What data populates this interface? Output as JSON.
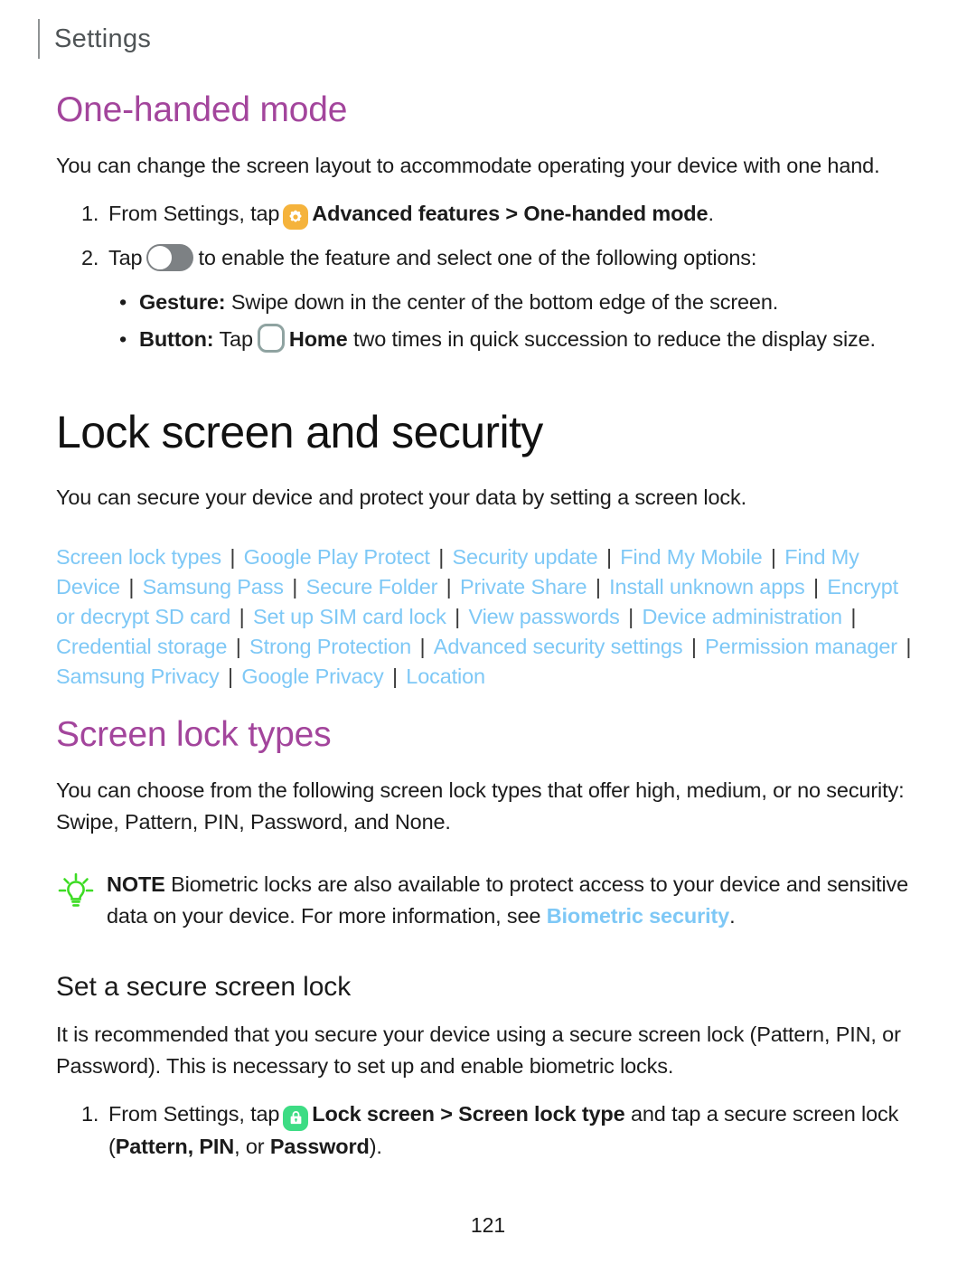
{
  "header": {
    "title": "Settings"
  },
  "one_handed": {
    "heading": "One-handed mode",
    "intro": "You can change the screen layout to accommodate operating your device with one hand.",
    "step1": {
      "number": "1.",
      "pre": "From Settings, tap",
      "icon": "gear-icon",
      "bold1": "Advanced features",
      "chevron": ">",
      "bold2": "One-handed mode",
      "post": "."
    },
    "step2": {
      "number": "2.",
      "pre": "Tap",
      "icon": "toggle-switch-off",
      "post": "to enable the feature and select one of the following options:"
    },
    "bullets": [
      {
        "dot": "•",
        "label": "Gesture",
        "colon": ":",
        "text": "Swipe down in the center of the bottom edge of the screen."
      },
      {
        "dot": "•",
        "label": "Button",
        "colon": ":",
        "pre": "Tap",
        "icon": "home-button-icon",
        "bold": "Home",
        "text": "two times in quick succession to reduce the display size."
      }
    ]
  },
  "lock_screen": {
    "heading": "Lock screen and security",
    "intro": "You can secure your device and protect your data by setting a screen lock.",
    "links": [
      "Screen lock types",
      "Google Play Protect",
      "Security update",
      "Find My Mobile",
      "Find My Device",
      "Samsung Pass",
      "Secure Folder",
      "Private Share",
      "Install unknown apps",
      "Encrypt or decrypt SD card",
      "Set up SIM card lock",
      "View passwords",
      "Device administration",
      "Credential storage",
      "Strong Protection",
      "Advanced security settings",
      "Permission manager",
      "Samsung Privacy",
      "Google Privacy",
      "Location"
    ],
    "link_separator": "|"
  },
  "screen_lock_types": {
    "heading": "Screen lock types",
    "intro": "You can choose from the following screen lock types that offer high, medium, or no security: Swipe, Pattern, PIN, Password, and None.",
    "note": {
      "icon": "lightbulb-icon",
      "label": "NOTE",
      "text_before_link": "Biometric locks are also available to protect access to your device and sensitive data on your device. For more information, see",
      "link": "Biometric security",
      "text_after_link": "."
    }
  },
  "set_secure_lock": {
    "heading": "Set a secure screen lock",
    "intro": "It is recommended that you secure your device using a secure screen lock (Pattern, PIN, or Password). This is necessary to set up and enable biometric locks.",
    "step1": {
      "number": "1.",
      "pre": "From Settings, tap",
      "icon": "lock-icon",
      "bold1": "Lock screen",
      "chevron": ">",
      "bold2": "Screen lock type",
      "mid": "and tap a secure screen lock (",
      "b_pattern": "Pattern",
      "c1": ",",
      "b_pin": "PIN",
      "c2": ", or",
      "b_password": "Password",
      "post": ")."
    }
  },
  "footer": {
    "page_number": "121"
  },
  "colors": {
    "heading_purple": "#a3459c",
    "link_blue": "#7ec8f6",
    "gear_orange": "#f5b33c",
    "lock_green": "#3ddc84",
    "bulb_green": "#3ddc24",
    "header_gray": "#4f5456",
    "toggle_gray": "#7d8184",
    "home_outline": "#8fa3a1"
  }
}
